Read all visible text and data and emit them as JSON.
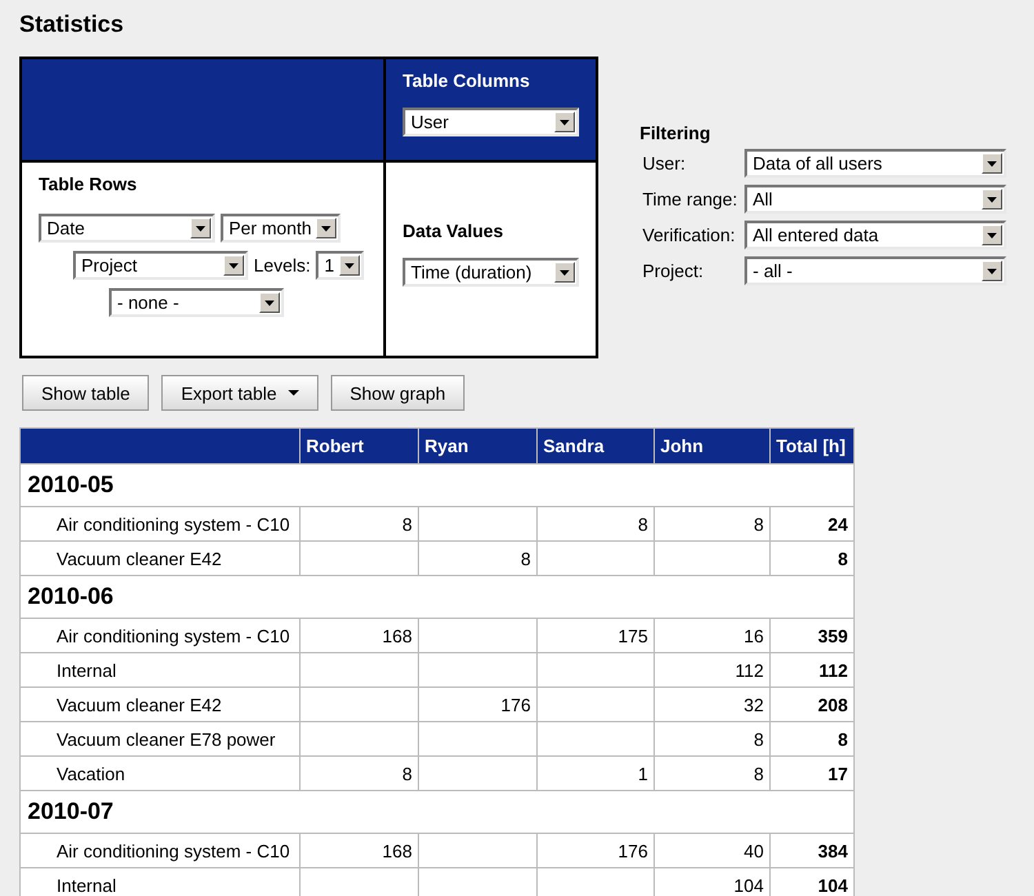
{
  "title": "Statistics",
  "config": {
    "columns": {
      "heading": "Table Columns",
      "select": "User"
    },
    "rows": {
      "heading": "Table Rows",
      "primary": "Date",
      "interval": "Per month",
      "secondary": "Project",
      "levels_label": "Levels:",
      "levels": "1",
      "tertiary": "- none -"
    },
    "values": {
      "heading": "Data Values",
      "select": "Time (duration)"
    }
  },
  "filtering": {
    "heading": "Filtering",
    "fields": [
      {
        "label": "User:",
        "value": "Data of all users"
      },
      {
        "label": "Time range:",
        "value": "All"
      },
      {
        "label": "Verification:",
        "value": "All entered data"
      },
      {
        "label": "Project:",
        "value": "- all -"
      }
    ]
  },
  "buttons": [
    {
      "label": "Show table",
      "kind": "plain"
    },
    {
      "label": "Export table",
      "kind": "menu"
    },
    {
      "label": "Show graph",
      "kind": "plain"
    }
  ],
  "table": {
    "columns": [
      "Robert",
      "Ryan",
      "Sandra",
      "John",
      "Total [h]"
    ],
    "groups": [
      {
        "label": "2010-05",
        "rows": [
          {
            "name": "Air conditioning system - C10",
            "cells": [
              "8",
              null,
              "8",
              "8"
            ],
            "total": "24"
          },
          {
            "name": "Vacuum cleaner E42",
            "cells": [
              null,
              "8",
              null,
              null
            ],
            "total": "8"
          }
        ]
      },
      {
        "label": "2010-06",
        "rows": [
          {
            "name": "Air conditioning system - C10",
            "cells": [
              "168",
              null,
              "175",
              "16"
            ],
            "total": "359"
          },
          {
            "name": "Internal",
            "cells": [
              null,
              null,
              null,
              "112"
            ],
            "total": "112"
          },
          {
            "name": "Vacuum cleaner E42",
            "cells": [
              null,
              "176",
              null,
              "32"
            ],
            "total": "208"
          },
          {
            "name": "Vacuum cleaner E78 power",
            "cells": [
              null,
              null,
              null,
              "8"
            ],
            "total": "8"
          },
          {
            "name": "Vacation",
            "cells": [
              "8",
              null,
              "1",
              "8"
            ],
            "total": "17"
          }
        ]
      },
      {
        "label": "2010-07",
        "rows": [
          {
            "name": "Air conditioning system - C10",
            "cells": [
              "168",
              null,
              "176",
              "40"
            ],
            "total": "384"
          },
          {
            "name": "Internal",
            "cells": [
              null,
              null,
              null,
              "104"
            ],
            "total": "104"
          }
        ]
      }
    ]
  }
}
